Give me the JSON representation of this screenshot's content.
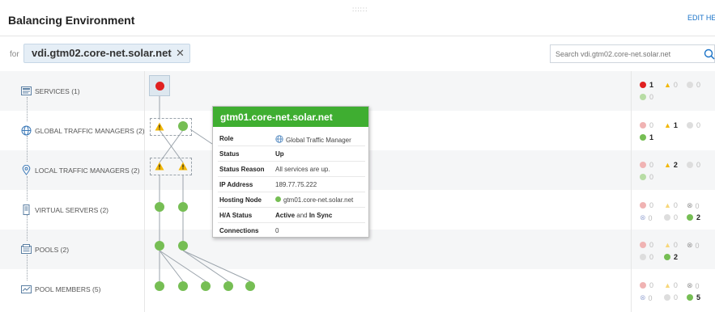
{
  "header": {
    "title": "Balancing Environment",
    "edit_help": "EDIT HELP",
    "grip": "::::::"
  },
  "filter": {
    "for_label": "for",
    "value": "vdi.gtm02.core-net.solar.net",
    "clear": "✕"
  },
  "search": {
    "placeholder": "Search vdi.gtm02.core-net.solar.net"
  },
  "rows": [
    {
      "label": "SERVICES (1)",
      "icon": "services-icon"
    },
    {
      "label": "GLOBAL TRAFFIC MANAGERS (2)",
      "icon": "globe-icon"
    },
    {
      "label": "LOCAL TRAFFIC MANAGERS (2)",
      "icon": "location-pin-icon"
    },
    {
      "label": "VIRTUAL SERVERS (2)",
      "icon": "virtual-server-icon"
    },
    {
      "label": "POOLS (2)",
      "icon": "pool-icon"
    },
    {
      "label": "POOL MEMBERS (5)",
      "icon": "pool-member-icon"
    }
  ],
  "status": {
    "services": {
      "critical": "1",
      "warning": "0",
      "unknown": "0",
      "up": "0"
    },
    "gtms": {
      "critical": "0",
      "warning": "1",
      "unknown": "0",
      "up": "1"
    },
    "ltms": {
      "critical": "0",
      "warning": "2",
      "unknown": "0",
      "up": "0"
    },
    "virtual_servers": {
      "critical": "0",
      "warning": "0",
      "down": "0",
      "unmanaged": "0",
      "unknown": "0",
      "up": "2"
    },
    "pools": {
      "critical": "0",
      "warning": "0",
      "down": "0",
      "unknown": "0",
      "up": "2"
    },
    "pool_members": {
      "critical": "0",
      "warning": "0",
      "down": "0",
      "unmanaged": "0",
      "unknown": "0",
      "up": "5"
    }
  },
  "popup": {
    "title": "gtm01.core-net.solar.net",
    "fields": {
      "role_label": "Role",
      "role_value": "Global Traffic Manager",
      "status_label": "Status",
      "status_value": "Up",
      "reason_label": "Status Reason",
      "reason_value": "All services are up.",
      "ip_label": "IP Address",
      "ip_value": "189.77.75.222",
      "node_label": "Hosting Node",
      "node_value": "gtm01.core-net.solar.net",
      "ha_label": "H/A Status",
      "ha_active": "Active",
      "ha_and": " and ",
      "ha_sync": "In Sync",
      "conn_label": "Connections",
      "conn_value": "0"
    }
  },
  "colors": {
    "up": "#76be54",
    "critical": "#e02020",
    "warning": "#f2b705",
    "popup_header": "#3fae31",
    "link": "#1a73c8"
  }
}
